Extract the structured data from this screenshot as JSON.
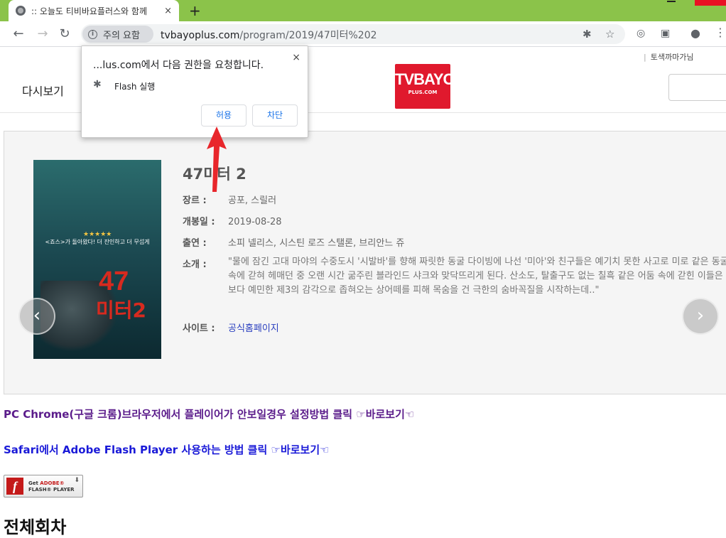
{
  "browser": {
    "tab_title": ":: 오늘도 티비바요플러스와 함께",
    "tab_close": "×",
    "new_tab": "+",
    "security_label": "주의 요함",
    "url_host": "tvbayoplus.com",
    "url_path": "/program/2019/47미터%202"
  },
  "site": {
    "header_link": "토색까마가님",
    "nav_replay": "다시보기",
    "logo_big": "TVBAYO",
    "logo_small": "PLUS.COM"
  },
  "movie": {
    "title": "47미터 2",
    "poster": {
      "number": "47",
      "subtitle": "미터2",
      "stars": "★★★★★",
      "tagline": "<죠스>가 돌아왔다! 더 잔인하고 더 무섭게"
    },
    "rows": [
      {
        "label": "장르 :",
        "value": "공포, 스릴러"
      },
      {
        "label": "개봉일 :",
        "value": "2019-08-28"
      },
      {
        "label": "출연 :",
        "value": "소피 넬리스, 시스틴 로즈 스탤론, 브리안느 쥬"
      },
      {
        "label": "소개 :",
        "value": ""
      }
    ],
    "synopsis": "\"물에 잠긴 고대 마야의 수중도시 '시발바'를 향해 짜릿한 동굴 다이빙에 나선 '미아'와 친구들은 예기치 못한 사고로 미로 같은 동굴 속에 갇혀 헤매던 중 오랜 시간 굶주린 블라인드 샤크와 맞닥뜨리게 된다. 산소도, 탈출구도 없는 칠흑 같은 어둠 속에 갇힌 이들은 눈 보다 예민한 제3의 감각으로 좁혀오는 상어떼를 피해 목숨을 건 극한의 숨바꼭질을 시작하는데..\"",
    "site_label": "사이트 :",
    "site_link": "공식홈페이지",
    "prev": "‹",
    "next": "›"
  },
  "help": {
    "chrome_line": "PC Chrome(구글 크롬)브라우저에서 플레이어가 안보일경우 설정방법 클릭 ☞바로보기☜",
    "safari_line": "Safari에서 Adobe Flash Player 사용하는 방법 클릭 ☞바로보기☜"
  },
  "flash_badge": {
    "get": "Get",
    "adobe": "ADOBE®",
    "player": "FLASH® PLAYER",
    "f": "f"
  },
  "episodes_heading": "전체회차",
  "permission_popup": {
    "message": "...lus.com에서 다음 권한을 요청합니다.",
    "permission": "Flash 실행",
    "allow": "허용",
    "block": "차단",
    "close": "×"
  },
  "colors": {
    "titlebar": "#8bc34a",
    "logo_red": "#e0192d",
    "help_purple": "#5b1c8b",
    "help_blue": "#1a1ad8",
    "arrow_red": "#e8262b"
  }
}
